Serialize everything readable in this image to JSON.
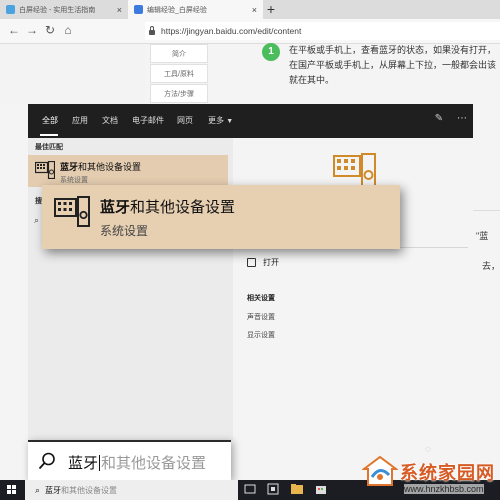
{
  "browser": {
    "tabs": [
      {
        "label": "白屏经验 - 实用生活指南"
      },
      {
        "label": "编辑经验_白屏经验"
      }
    ],
    "new_tab": "+",
    "url": "https://jingyan.baidu.com/edit/content"
  },
  "page": {
    "nav_items": [
      "简介",
      "工具/原料",
      "方法/步骤"
    ],
    "step_number": "1",
    "step_text": "在平板或手机上，查看蓝牙的状态，如果没有打开，在国产平板或手机上，从屏幕上下拉，一般都会出该就在其中。",
    "right_fragments": [
      "\"蓝",
      "去，"
    ]
  },
  "search_panel": {
    "tabs": [
      "全部",
      "应用",
      "文档",
      "电子邮件",
      "网页",
      "更多"
    ],
    "best_match_title": "最佳匹配",
    "best_match": {
      "title_bold": "蓝牙",
      "title_rest": "和其他设备设置",
      "subtitle": "系统设置"
    },
    "left_section_fragment": "搜",
    "callout": {
      "title_bold": "蓝牙",
      "title_rest": "和其他设备设置",
      "subtitle": "系统设置"
    },
    "open_label": "打开",
    "related_title": "相关设置",
    "related_items": [
      "声音设置",
      "显示设置"
    ],
    "search_query": "蓝牙",
    "search_suggestion": "和其他设备设置"
  },
  "taskbar": {
    "search_query": "蓝牙",
    "search_suggestion": "和其他设备设置"
  },
  "watermark": {
    "site_name": "系统家园网",
    "url": "www.hnzkhbsb.com"
  },
  "colors": {
    "highlight": "#e3ccb0",
    "panel_dark": "#2b2b2b",
    "step_green": "#4bbd5d",
    "watermark_orange": "#d65b24"
  }
}
